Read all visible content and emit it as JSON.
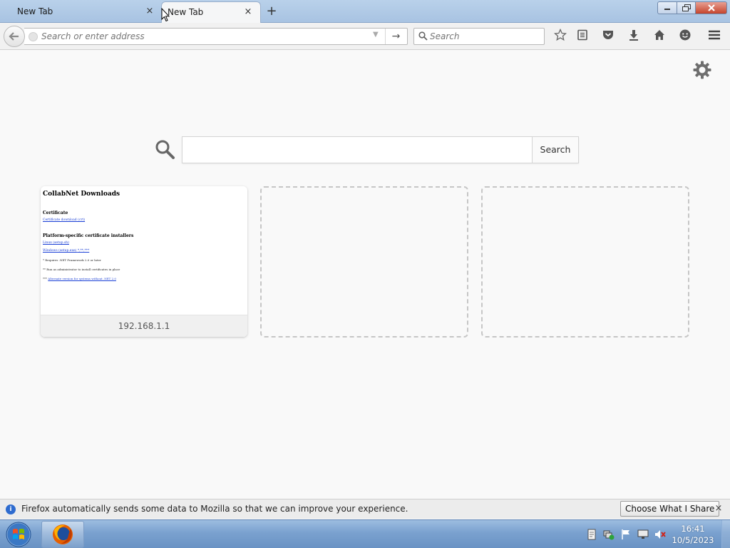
{
  "browser": {
    "tabs": [
      {
        "label": "New Tab",
        "active": false
      },
      {
        "label": "New Tab",
        "active": true
      }
    ],
    "new_tab_symbol": "+",
    "close_symbol": "×",
    "url_placeholder": "Search or enter address",
    "search_placeholder": "Search"
  },
  "window_buttons": {
    "minimize_icon": "minimize-icon",
    "maximize_icon": "restore-icon",
    "close_icon": "close-icon"
  },
  "toolbar_icons": [
    "bookmark-star-icon",
    "reading-list-icon",
    "pocket-icon",
    "downloads-icon",
    "home-icon",
    "hello-chat-icon",
    "menu-icon"
  ],
  "newtab": {
    "search_button": "Search",
    "tiles": [
      {
        "caption": "192.168.1.1",
        "thumbnail": {
          "heading": "CollabNet Downloads",
          "section1": "Certificate",
          "link1": "Certificate download (crt)",
          "section2": "Platform-specific certificate installers",
          "link2": "Linux (setup.sh)",
          "link3": "Windows (setup.exe)",
          "link3_suffix": "*,**,***",
          "note1": "* Requires .NET Framework 2.0 or later",
          "note2": "** Run as administrator to install certificates in place",
          "note3_prefix": "***",
          "note3_link": "Alternate version for systems without .NET 2.0"
        }
      },
      {
        "caption": ""
      },
      {
        "caption": ""
      }
    ]
  },
  "notification": {
    "message": "Firefox automatically sends some data to Mozilla so that we can improve your experience.",
    "button": "Choose What I Share",
    "close": "×"
  },
  "taskbar": {
    "time": "16:41",
    "date": "10/5/2023",
    "tray_icons": [
      "action-center-icon",
      "network-icon",
      "flag-icon",
      "display-icon",
      "volume-muted-icon"
    ]
  },
  "colors": {
    "accent_blue": "#2d6bcf",
    "titlebar": "#b9d1ea",
    "taskbar": "#7aa1cf"
  }
}
